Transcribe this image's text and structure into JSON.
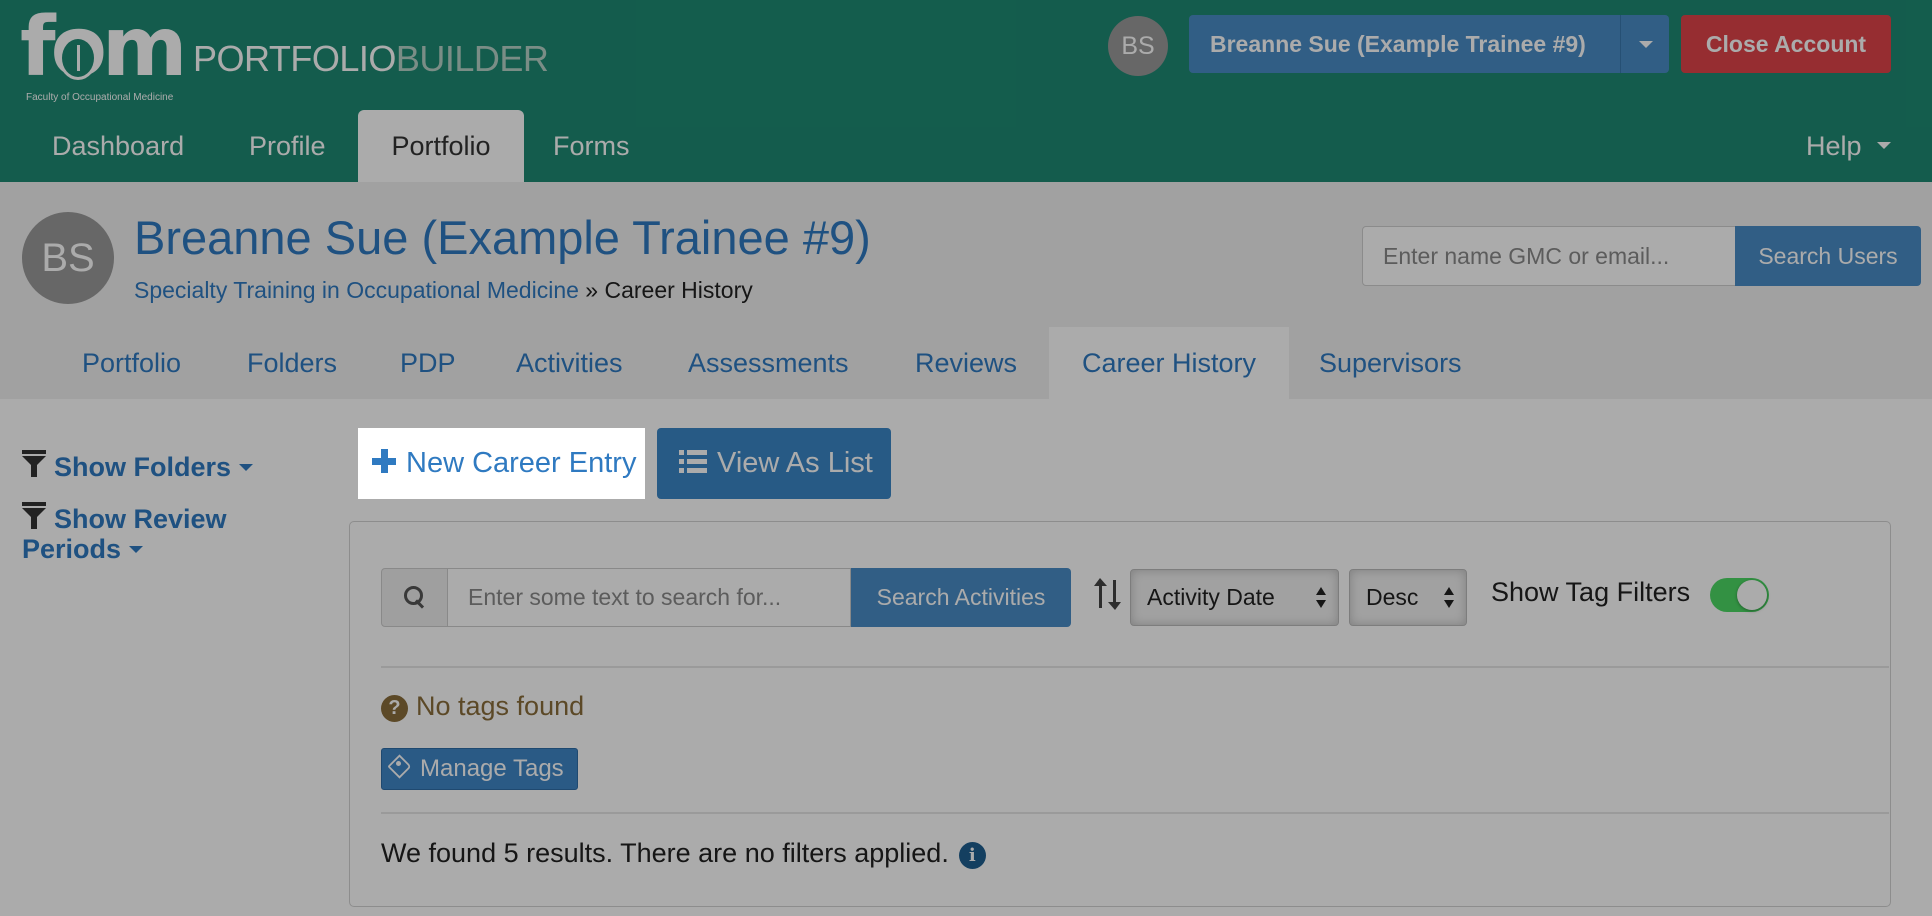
{
  "brand": {
    "logo_text": "fom",
    "logo_subtitle": "Faculty of Occupational Medicine",
    "app_name_part1": "PORTFOLIO",
    "app_name_part2": "BUILDER"
  },
  "header": {
    "avatar_initials": "BS",
    "user_button_label": "Breanne Sue (Example Trainee #9)",
    "close_account_label": "Close Account"
  },
  "main_nav": {
    "tabs": [
      {
        "label": "Dashboard"
      },
      {
        "label": "Profile"
      },
      {
        "label": "Portfolio"
      },
      {
        "label": "Forms"
      }
    ],
    "active": "Portfolio",
    "help_label": "Help"
  },
  "page_header": {
    "avatar_initials": "BS",
    "title": "Breanne Sue (Example Trainee #9)",
    "breadcrumb_link": "Specialty Training in Occupational Medicine",
    "breadcrumb_separator": " » ",
    "breadcrumb_current": "Career History",
    "user_search_placeholder": "Enter name GMC or email...",
    "user_search_button": "Search Users"
  },
  "sub_nav": {
    "tabs": [
      {
        "label": "Portfolio"
      },
      {
        "label": "Folders"
      },
      {
        "label": "PDP"
      },
      {
        "label": "Activities"
      },
      {
        "label": "Assessments"
      },
      {
        "label": "Reviews"
      },
      {
        "label": "Career History"
      },
      {
        "label": "Supervisors"
      }
    ],
    "active": "Career History"
  },
  "sidebar": {
    "show_folders": "Show Folders",
    "show_review_periods_line1": "Show Review",
    "show_review_periods_line2": "Periods"
  },
  "actions": {
    "new_entry_label": "New Career Entry",
    "view_list_label": "View As List"
  },
  "filters": {
    "search_placeholder": "Enter some text to search for...",
    "search_button": "Search Activities",
    "sort_field": "Activity Date",
    "sort_order": "Desc",
    "tag_filters_label": "Show Tag Filters",
    "tag_filters_on": true
  },
  "tags": {
    "empty_message": "No tags found",
    "manage_label": "Manage Tags"
  },
  "results": {
    "summary": "We found 5 results. There are no filters applied."
  },
  "colors": {
    "brand_green": "#1e8a73",
    "primary_blue": "#4a8dc6",
    "link_blue": "#2f7ac1",
    "danger_red": "#e0444a",
    "warning_brown": "#8a6d3b",
    "toggle_green": "#4cd964"
  },
  "icons": {
    "logo": "fom-seal-icon",
    "user_caret": "chevron-down-icon",
    "help_caret": "chevron-down-icon",
    "filter": "funnel-icon",
    "new_entry": "plus-icon",
    "view_list": "list-icon",
    "search": "search-icon",
    "sort": "sort-icon",
    "no_tags": "question-circle-icon",
    "manage_tags": "tags-icon",
    "info": "info-circle-icon"
  }
}
